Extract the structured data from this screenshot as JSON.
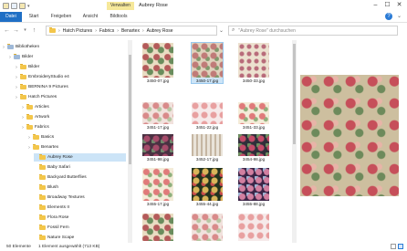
{
  "window": {
    "title": "Aubrey Rose",
    "tool_tab": "Verwalten"
  },
  "ribbon_tabs": [
    "Datei",
    "Start",
    "Freigeben",
    "Ansicht",
    "Bildtools"
  ],
  "address": {
    "crumbs": [
      "Hatch Pictures",
      "Fabrics",
      "Benartex",
      "Aubrey Rose"
    ]
  },
  "search": {
    "placeholder": "\"Aubrey Rose\" durchsuchen"
  },
  "nav": {
    "items": [
      {
        "label": "Bibliotheken",
        "level": 0,
        "type": "lib"
      },
      {
        "label": "Bilder",
        "level": 1,
        "type": "lib"
      },
      {
        "label": "Bilder",
        "level": 2,
        "type": "folder"
      },
      {
        "label": "EmbroideryStudio e4",
        "level": 2,
        "type": "folder"
      },
      {
        "label": "BERNINA 9 Pictures",
        "level": 2,
        "type": "folder"
      },
      {
        "label": "Hatch Pictures",
        "level": 2,
        "type": "folder"
      },
      {
        "label": "Articles",
        "level": 3,
        "type": "folder"
      },
      {
        "label": "Artwork",
        "level": 3,
        "type": "folder"
      },
      {
        "label": "Fabrics",
        "level": 3,
        "type": "folder"
      },
      {
        "label": "Basics",
        "level": 4,
        "type": "folder"
      },
      {
        "label": "Benartex",
        "level": 4,
        "type": "folder"
      },
      {
        "label": "Aubrey Rose",
        "level": 5,
        "type": "folder",
        "selected": true
      },
      {
        "label": "Baby Safari",
        "level": 5,
        "type": "folder"
      },
      {
        "label": "Backyard Butterflies",
        "level": 5,
        "type": "folder"
      },
      {
        "label": "Blush",
        "level": 5,
        "type": "folder"
      },
      {
        "label": "Broadway Textures",
        "level": 5,
        "type": "folder"
      },
      {
        "label": "Elements II",
        "level": 5,
        "type": "folder"
      },
      {
        "label": "Flora Rose",
        "level": 5,
        "type": "folder"
      },
      {
        "label": "Fossil Fern",
        "level": 5,
        "type": "folder"
      },
      {
        "label": "Nature Scape",
        "level": 5,
        "type": "folder"
      }
    ]
  },
  "files": [
    {
      "name": "3450-07.jpg",
      "pattern": "p1"
    },
    {
      "name": "3450-17.jpg",
      "pattern": "p2",
      "selected": true
    },
    {
      "name": "3450-33.jpg",
      "pattern": "p3"
    },
    {
      "name": "3451-17.jpg",
      "pattern": "p4"
    },
    {
      "name": "3451-22.jpg",
      "pattern": "p11"
    },
    {
      "name": "3451-33.jpg",
      "pattern": "p8"
    },
    {
      "name": "3451-98.jpg",
      "pattern": "p5"
    },
    {
      "name": "3452-17.jpg",
      "pattern": "p6"
    },
    {
      "name": "3454-98.jpg",
      "pattern": "p7"
    },
    {
      "name": "3455-17.jpg",
      "pattern": "p8"
    },
    {
      "name": "3455-44.jpg",
      "pattern": "p9"
    },
    {
      "name": "3455-88.jpg",
      "pattern": "p10"
    },
    {
      "name": "",
      "pattern": "p1"
    },
    {
      "name": "",
      "pattern": "p4"
    },
    {
      "name": "",
      "pattern": "p11"
    }
  ],
  "status": {
    "count": "50 Elemente",
    "selection": "1 Element ausgewählt (713 KB)"
  }
}
